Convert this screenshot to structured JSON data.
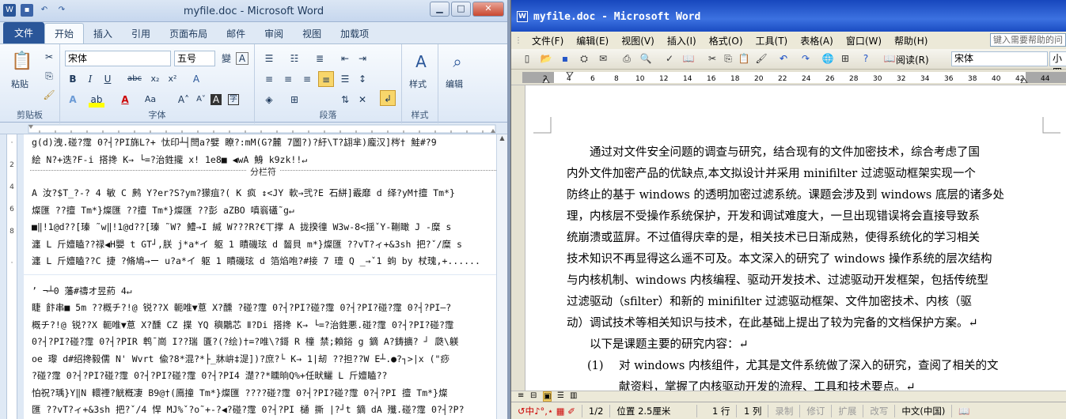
{
  "left_window": {
    "title": "myfile.doc - Microsoft Word",
    "tabs": [
      "文件",
      "开始",
      "插入",
      "引用",
      "页面布局",
      "邮件",
      "审阅",
      "视图",
      "加载项"
    ],
    "active_tab": "开始",
    "font_name": "宋体",
    "font_size": "五号",
    "groups": {
      "clipboard": "剪贴板",
      "font": "字体",
      "paragraph": "段落",
      "styles": "样式",
      "editing": "编辑"
    },
    "paste_label": "粘贴",
    "styles_label": "样式",
    "editing_label": "编辑",
    "section_break": "分栏符",
    "garbled_lines": [
      "g(d)洩.碰?霪 0?┤?PI旆L?+  忲印┴┤閆a?嬖 瞭?:mM(G?麓 7圖?)?紆\\T?翃芈)龐汉]梣† 鮭#?9",
      "絵 N?+迭?F-i 搭搀 K→ └=?治鉎攏 x! 1e8■ ◀wA 鯓 k9zk!!↵"
    ],
    "garbled_lines_2": [
      "A 汝?$T_?-? 4 敏 C 鹒 Y?er?S?ym?獴疽?(   K 疯   ↕<JY 軟→弐?E 石絣]霰靡 d 绎?yM†擅 Tm*}",
      "燦匯   ??擅 Tm*}燦匯   ??擅 Tm*}燦匯   ??彭 aZBO 嗔嵡礚˜g↵",
      "■‖!1@d??[瑧 ˜w‖!1@d??[瑧 ˜W? 鱧→I 緘 W???R?€丅撑 A 拢揆徸 W3w-8<揺ˇY-鞩瞰 J -糜 s",
      "瀍 L 斤嬗瞌??禄◀H嬰 t    GT┘,朕 j*a*イ 躯 1 瞔磯玹 d 齧貝 m*}燦匯   ??vT?ィ+&3sh 把?ˇ/糜 s",
      "瀍 L 斤嬗瞌??C 捷  ?脩鳩→ー u?a*イ 躯 1 瞔磯玹 d 箔焰咆?#接 7 璮 Q  _→ˇ1 蚼 by 杖瑰,+......"
    ],
    "garbled_lines_3": [
      "ʼ ¬┴0 藩#禱オ昱葯 4↵",
      " 睫 飰串■ 5m   ??概チ?!@ 锐??X 軛唯▼蒠 X?醺 ?碰?霪 0?┤?PI?碰?霪 0?┤?PI?碰?霪 0?┤?PI—?",
      "概チ?!@ 锐??X 軛唯▼蒠 X?醺 CZ 揲 YQ 穥鷴芯 Ⅱ?Di 搭搀 K→ └=?治鉎悪.碰?霪  0?┤?PI?碰?霪",
      "0?┤?PI?碰?霪 0?┤?PIR 鹎ˉ崗 I??瑞 匱?(?绘)†=?唯\\?鎶 R 橦 禁;賴鋊 g 鏑 A?鋳擴? ┘ 瓞\\躾",
      "oe 瓈 d#绍搀毅儒 N' Wvrt 偸?8*混?*├_牀峅‡湜])?庶?└ K→ 1|刼  ??担??W E┴.●?┐>|x   (\"痧",
      " ?碰?霪 0?┤?PI?碰?霪 0?┤?PI?碰?霪 0?┤?PI4 濋??*矄晌Q%+任畎鱺 L 斤嬗瞌??",
      "怕祝?瑀}Y‖N 轘禋?觥槪凄 B9@†(鳫撞 Tm*}燦匯   ????碰?霪 0?┤?PI?碰?霪 0?┤?PI 擅 Tm*}燦",
      "匯   ??vT?ィ+&3sh 把?ˇ/4 悍 MJ%ˇ?o˜+-?◀?碰?霪 0?┤?PI 樋   撕   |?┘t 鏑 dA 殲.碰?霪 0?┤?P?"
    ],
    "ruler_marks": [
      "2",
      "4",
      "6",
      "8",
      "10",
      "12",
      "14",
      "16",
      "18",
      "20",
      "22",
      "24",
      "26",
      "28",
      "30",
      "32",
      "34",
      "36",
      "38",
      "40",
      "42"
    ]
  },
  "right_window": {
    "title": "myfile.doc - Microsoft Word",
    "menus": [
      "文件(F)",
      "编辑(E)",
      "视图(V)",
      "插入(I)",
      "格式(O)",
      "工具(T)",
      "表格(A)",
      "窗口(W)",
      "帮助(H)"
    ],
    "help_placeholder": "键入需要帮助的问",
    "reading_label": "阅读(R)",
    "font_name": "宋体",
    "font_size": "小四",
    "ruler_marks": [
      "2",
      "4",
      "6",
      "8",
      "10",
      "12",
      "14",
      "16",
      "18",
      "20",
      "22",
      "24",
      "26",
      "28",
      "30",
      "32",
      "34",
      "36",
      "38",
      "40",
      "42",
      "44"
    ],
    "para1_lines": [
      "通过对文件安全问题的调查与研究，结合现有的文件加密技术，综合考虑了国",
      "内外文件加密产品的优缺点,本文拟设计并采用 minifilter 过滤驱动框架实现一个",
      "防终止的基于 windows 的透明加密过滤系统。课题会涉及到 windows 底层的诸多处",
      "理，内核层不受操作系统保护，开发和调试难度大，一旦出现错误将会直接导致系",
      "统崩溃或蓝屏。不过值得庆幸的是，相关技术已日渐成熟，使得系统化的学习相关",
      "技术知识不再显得这么遥不可及。本文深入的研究了 windows 操作系统的层次结构",
      "与内核机制、windows 内核编程、驱动开发技术、过滤驱动开发框架，包括传统型",
      "过滤驱动（sfilter）和新的 minifilter 过滤驱动框架、文件加密技术、内核（驱",
      "动）调试技术等相关知识与技术，在此基础上提出了较为完备的文档保护方案。↵"
    ],
    "para2": "以下是课题主要的研究内容：↵",
    "list_num": "(1)",
    "list_lines": [
      "对 windows 内核组件，尤其是文件系统做了深入的研究，查阅了相关的文",
      "献资料，掌握了内核驱动开发的流程、工具和技术要点。↵"
    ],
    "status": {
      "page_count": "1/2",
      "position": "位置 2.5厘米",
      "line": "1 行",
      "col": "1 列",
      "rec": "录制",
      "rev": "修订",
      "ext": "扩展",
      "ovr": "改写",
      "lang": "中文(中国)"
    }
  }
}
